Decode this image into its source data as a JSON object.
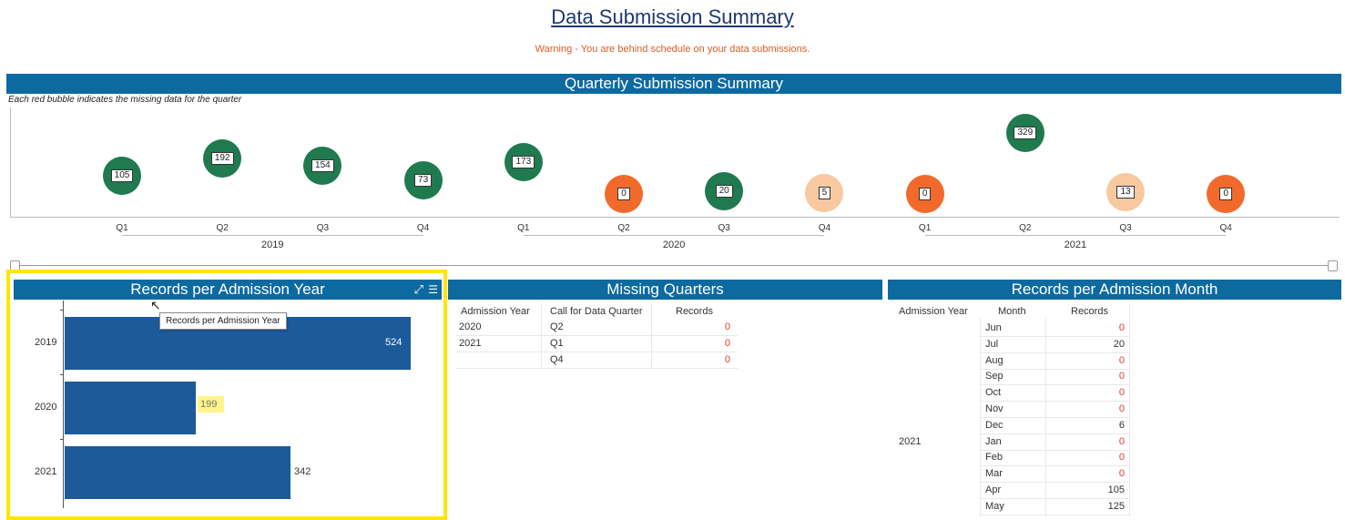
{
  "page": {
    "title": "Data Submission Summary",
    "warning": "Warning - You are behind schedule on your data submissions."
  },
  "colors": {
    "band": "#0d6aa0",
    "complete": "#1f7a4f",
    "missing": "#f26a2b",
    "partial": "#f8c9a0",
    "bar": "#1c5a9c",
    "highlight": "#ffe600"
  },
  "quarterly": {
    "header": "Quarterly Submission Summary",
    "note": "Each red bubble indicates the missing data for the quarter",
    "bubbles": [
      {
        "quarter": "Q1",
        "year": "2019",
        "value": "105",
        "status": "complete"
      },
      {
        "quarter": "Q2",
        "year": "2019",
        "value": "192",
        "status": "complete"
      },
      {
        "quarter": "Q3",
        "year": "2019",
        "value": "154",
        "status": "complete"
      },
      {
        "quarter": "Q4",
        "year": "2019",
        "value": "73",
        "status": "complete"
      },
      {
        "quarter": "Q1",
        "year": "2020",
        "value": "173",
        "status": "complete"
      },
      {
        "quarter": "Q2",
        "year": "2020",
        "value": "0",
        "status": "missing"
      },
      {
        "quarter": "Q3",
        "year": "2020",
        "value": "20",
        "status": "complete"
      },
      {
        "quarter": "Q4",
        "year": "2020",
        "value": "5",
        "status": "partial"
      },
      {
        "quarter": "Q1",
        "year": "2021",
        "value": "0",
        "status": "missing"
      },
      {
        "quarter": "Q2",
        "year": "2021",
        "value": "329",
        "status": "complete"
      },
      {
        "quarter": "Q3",
        "year": "2021",
        "value": "13",
        "status": "partial"
      },
      {
        "quarter": "Q4",
        "year": "2021",
        "value": "0",
        "status": "missing"
      }
    ],
    "years": [
      "2019",
      "2020",
      "2021"
    ]
  },
  "admission_year": {
    "header": "Records per Admission Year",
    "tooltip": "Records per Admission Year",
    "chart_data": {
      "type": "bar",
      "orientation": "horizontal",
      "categories": [
        "2019",
        "2020",
        "2021"
      ],
      "values": [
        524,
        199,
        342
      ],
      "title": "Records per Admission Year"
    }
  },
  "missing_quarters": {
    "header": "Missing Quarters",
    "columns": [
      "Admission Year",
      "Call for Data Quarter",
      "Records"
    ],
    "rows": [
      {
        "year": "2020",
        "quarter": "Q2",
        "records": "0"
      },
      {
        "year": "2021",
        "quarter": "Q1",
        "records": "0"
      },
      {
        "year": "",
        "quarter": "Q4",
        "records": "0"
      }
    ]
  },
  "admission_month": {
    "header": "Records per Admission Month",
    "columns": [
      "Admission Year",
      "Month",
      "Records"
    ],
    "rows": [
      {
        "year": "",
        "month": "Jun",
        "records": "0",
        "zero": true
      },
      {
        "year": "",
        "month": "Jul",
        "records": "20",
        "zero": false
      },
      {
        "year": "",
        "month": "Aug",
        "records": "0",
        "zero": true
      },
      {
        "year": "",
        "month": "Sep",
        "records": "0",
        "zero": true
      },
      {
        "year": "",
        "month": "Oct",
        "records": "0",
        "zero": true
      },
      {
        "year": "",
        "month": "Nov",
        "records": "0",
        "zero": true
      },
      {
        "year": "",
        "month": "Dec",
        "records": "6",
        "zero": false
      },
      {
        "year": "2021",
        "month": "Jan",
        "records": "0",
        "zero": true
      },
      {
        "year": "",
        "month": "Feb",
        "records": "0",
        "zero": true
      },
      {
        "year": "",
        "month": "Mar",
        "records": "0",
        "zero": true
      },
      {
        "year": "",
        "month": "Apr",
        "records": "105",
        "zero": false
      },
      {
        "year": "",
        "month": "May",
        "records": "125",
        "zero": false
      }
    ]
  }
}
